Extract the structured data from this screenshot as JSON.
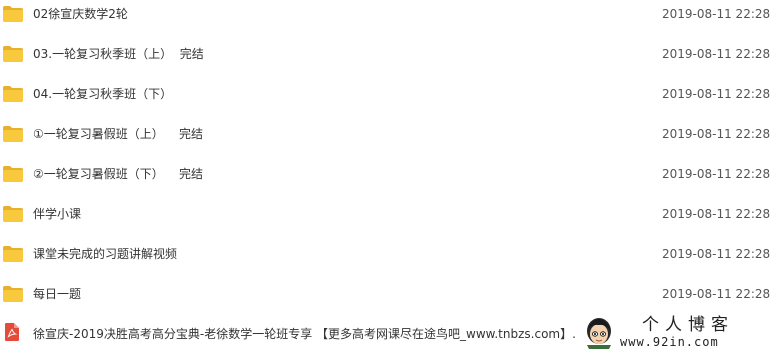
{
  "files": [
    {
      "icon": "folder-icon",
      "name": "02徐宣庆数学2轮",
      "date": "2019-08-11 22:28"
    },
    {
      "icon": "folder-icon",
      "name": "03.一轮复习秋季班（上）  完结",
      "date": "2019-08-11 22:28"
    },
    {
      "icon": "folder-icon",
      "name": "04.一轮复习秋季班（下）",
      "date": "2019-08-11 22:28"
    },
    {
      "icon": "folder-icon",
      "name": "①一轮复习暑假班（上）    完结",
      "date": "2019-08-11 22:28"
    },
    {
      "icon": "folder-icon",
      "name": "②一轮复习暑假班（下）    完结",
      "date": "2019-08-11 22:28"
    },
    {
      "icon": "folder-icon",
      "name": "伴学小课",
      "date": "2019-08-11 22:28"
    },
    {
      "icon": "folder-icon",
      "name": "课堂未完成的习题讲解视频",
      "date": "2019-08-11 22:28"
    },
    {
      "icon": "folder-icon",
      "name": "每日一题",
      "date": "2019-08-11 22:28"
    },
    {
      "icon": "pdf-icon",
      "name": "徐宣庆-2019决胜高考高分宝典-老徐数学一轮班专享 【更多高考网课尽在途鸟吧_www.tnbzs.com】.",
      "date": ""
    }
  ],
  "watermark": {
    "title": "个人博客",
    "url": "www.92in.com"
  },
  "colors": {
    "folder_body": "#F8C93C",
    "folder_tab": "#E8B02A",
    "pdf_red": "#E44B3A",
    "text": "#333333",
    "date_text": "#555555"
  }
}
